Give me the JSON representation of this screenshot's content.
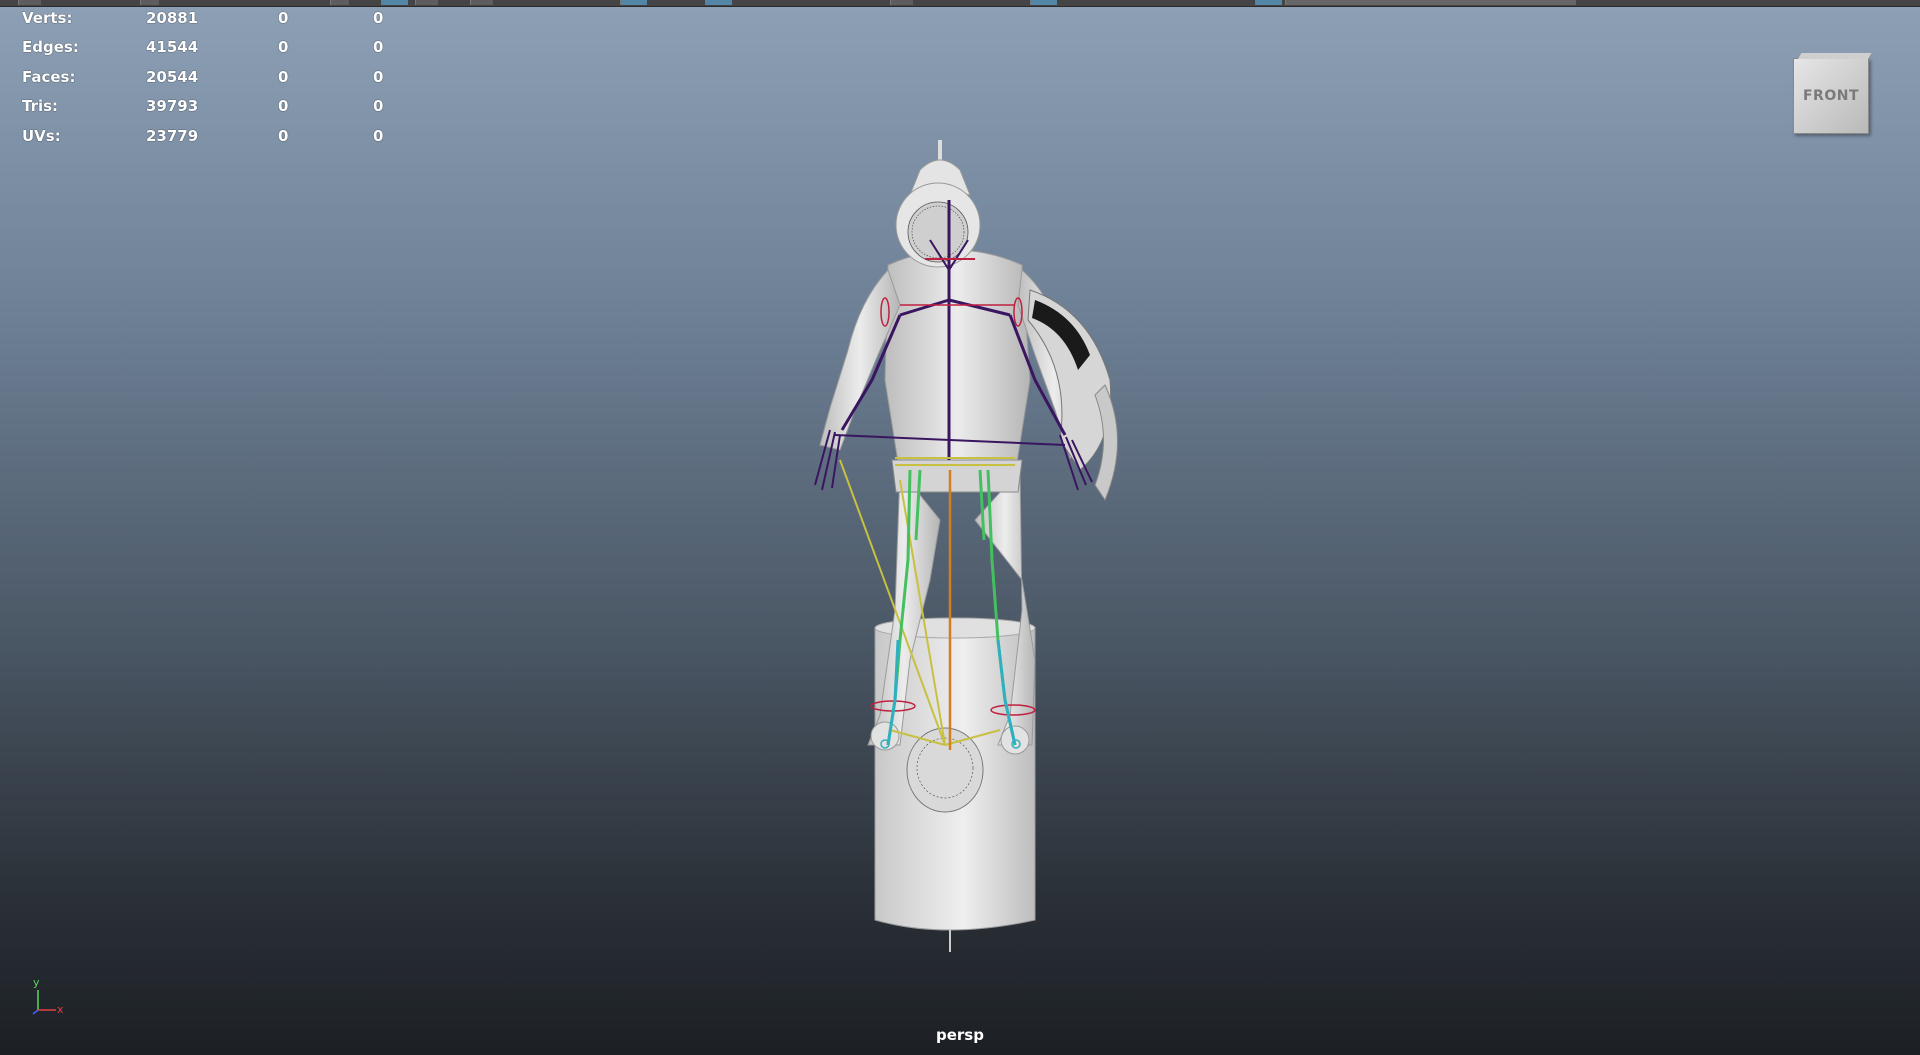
{
  "viewport": {
    "camera": "persp",
    "view_cube_label": "FRONT"
  },
  "heads_up_display": {
    "rows": [
      {
        "label": "Verts:",
        "values": [
          "20881",
          "0",
          "0"
        ]
      },
      {
        "label": "Edges:",
        "values": [
          "41544",
          "0",
          "0"
        ]
      },
      {
        "label": "Faces:",
        "values": [
          "20544",
          "0",
          "0"
        ]
      },
      {
        "label": "Tris:",
        "values": [
          "39793",
          "0",
          "0"
        ]
      },
      {
        "label": "UVs:",
        "values": [
          "23779",
          "0",
          "0"
        ]
      }
    ]
  },
  "axis_gizmo": {
    "y_label": "y",
    "x_label": "x",
    "y_color": "#5cd65c",
    "x_color": "#e04040",
    "z_color": "#4060ff"
  },
  "colors": {
    "background_top": "#8da0b6",
    "background_bottom": "#1c2025",
    "hud_text": "#ffffff",
    "model_surface": "#d8d8d8",
    "joint_upper": "#3a1560",
    "joint_legs": "#44c060",
    "joint_feet": "#2fb0c0",
    "ik_lines": "#c8c040",
    "center_line": "#d08020",
    "control_rings": "#c02040"
  }
}
